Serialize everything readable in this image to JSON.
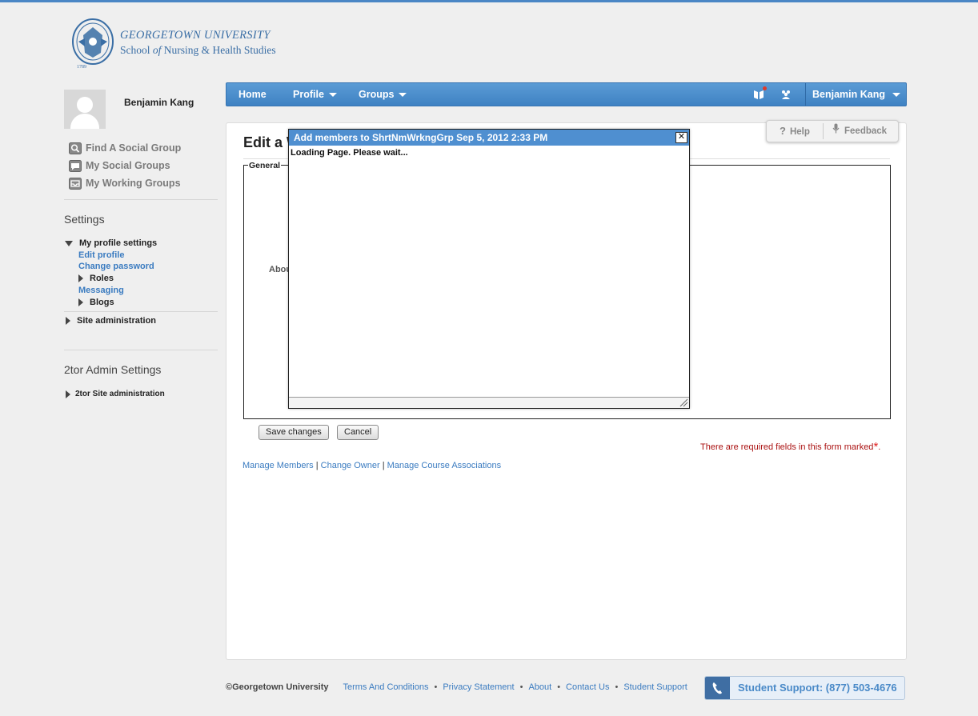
{
  "brand": {
    "line1": "GEORGETOWN UNIVERSITY",
    "line2_a": "School ",
    "line2_of": "of",
    "line2_b": " Nursing & Health Studies",
    "seal_year": "1789",
    "colors": {
      "brand_blue": "#3a6ea5",
      "nav_blue": "#4a8ac8",
      "link_blue": "#3a7bc0",
      "required_red": "#a11111"
    }
  },
  "sidebar": {
    "user_name": "Benjamin Kang",
    "links": [
      {
        "label": "Find A Social Group",
        "icon": "magnifier-icon"
      },
      {
        "label": "My Social Groups",
        "icon": "speech-bubble-icon"
      },
      {
        "label": "My Working Groups",
        "icon": "inbox-icon"
      }
    ],
    "settings_title": "Settings",
    "profile_settings": "My profile settings",
    "edit_profile": "Edit profile",
    "change_password": "Change password",
    "roles": "Roles",
    "messaging": "Messaging",
    "blogs": "Blogs",
    "site_admin": "Site administration",
    "admin_title": "2tor Admin Settings",
    "admin_site_admin": "2tor Site administration"
  },
  "navbar": {
    "home": "Home",
    "profile": "Profile",
    "groups": "Groups",
    "user_menu": "Benjamin Kang",
    "icons": [
      "book-icon",
      "people-icon"
    ]
  },
  "help": {
    "help_label": "Help",
    "feedback_label": "Feedback"
  },
  "main": {
    "heading": "Edit a W",
    "legend": "General",
    "about_label": "Abou",
    "save_label": "Save changes",
    "cancel_label": "Cancel",
    "required_text": "There are required fields in this form marked",
    "required_star": "*",
    "required_end": ".",
    "links": {
      "manage_members": "Manage Members",
      "change_owner": "Change Owner",
      "course_assoc": "Manage Course Associations",
      "sep": " | "
    }
  },
  "dialog": {
    "title": "Add members to ShrtNmWrkngGrp Sep 5, 2012 2:33 PM",
    "close": "✕",
    "body": "Loading Page. Please wait..."
  },
  "footer": {
    "copyright": "©Georgetown University",
    "links": [
      "Terms And Conditions",
      "Privacy Statement",
      "About",
      "Contact Us",
      "Student Support"
    ],
    "support_label": "Student Support: (877) 503-4676"
  }
}
